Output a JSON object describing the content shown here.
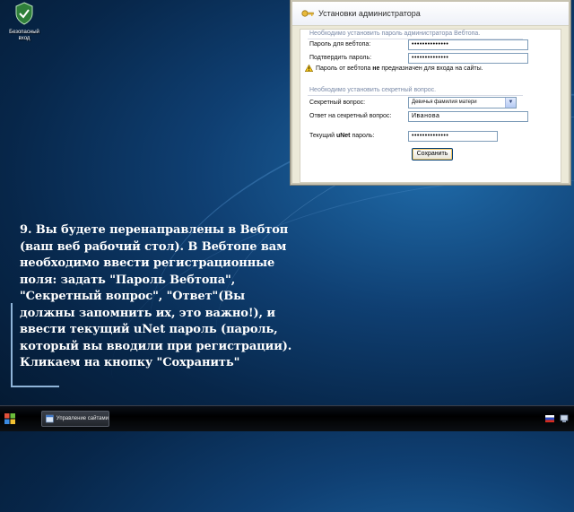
{
  "desktop": {
    "icon_label_line1": "Безопасный",
    "icon_label_line2": "вход",
    "icon": "shield-check-icon"
  },
  "dialog": {
    "title": "Установки администратора",
    "section1_title": "Необходимо установить пароль администратора Вебтопа.",
    "password_label": "Пароль для вебтопа:",
    "password_value": "••••••••••••••",
    "confirm_label": "Подтвердить пароль:",
    "confirm_value": "••••••••••••••",
    "warning_pre": "Пароль от вебтопа ",
    "warning_bold": "не",
    "warning_post": " предназначен для входа на сайты.",
    "section2_title": "Необходимо установить секретный вопрос.",
    "secret_question_label": "Секретный вопрос:",
    "secret_question_value": "Девичья фамилия матери",
    "answer_label": "Ответ на секретный вопрос:",
    "answer_value": "Иванова",
    "current_label_pre": "Текущий ",
    "current_label_bold": "uNet",
    "current_label_post": " пароль:",
    "current_value": "••••••••••••••",
    "save_button": "Сохранить"
  },
  "caption": {
    "lines": [
      "9. Вы будете перенаправлены в Вебтоп",
      "(ваш веб рабочий стол). В Вебтопе вам",
      "необходимо ввести регистрационные",
      "поля: задать \"Пароль Вебтопа\",",
      "\"Секретный вопрос\", \"Ответ\"(Вы",
      "должны запомнить их, это важно!), и",
      "ввести текущий uNet пароль (пароль,",
      "который вы вводили при регистрации).",
      "Кликаем на кнопку \"Сохранить\""
    ]
  },
  "taskbar": {
    "window_button_label": "Управление сайтами"
  },
  "colors": {
    "desktop_bg": "#0f3f72",
    "dialog_bg": "#ece9d8",
    "section_title": "#7a8aa8",
    "caption_text": "#ffffff"
  }
}
